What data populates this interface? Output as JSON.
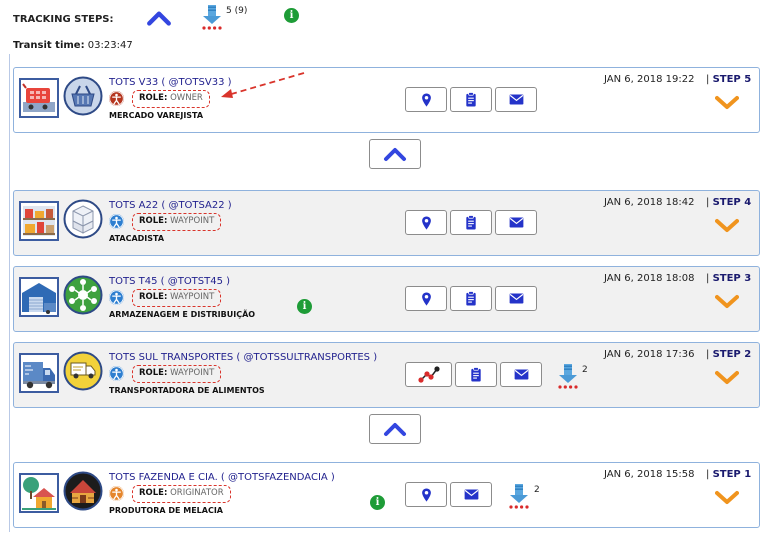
{
  "header": {
    "tracking_label": "TRACKING STEPS:",
    "download_count": "5 (9)",
    "info_symbol": "i",
    "transit_label": "Transit time:",
    "transit_value": "03:23:47"
  },
  "colors": {
    "card_border": "#8fb2dd",
    "link_blue": "#23238f",
    "role_dashed": "#d9342b",
    "chevron_orange": "#f0941e",
    "collapse_arrow": "#3346e0",
    "info_green": "#1e9c37"
  },
  "steps": [
    {
      "name": "TOTS V33 ( @TOTSV33 )",
      "role_key": "ROLE:",
      "role_value": "OWNER",
      "description": "MERCADO VAREJISTA",
      "date": "JAN 6, 2018 19:22",
      "step_prefix": "|",
      "step_label": "STEP 5",
      "actions": [
        "map-pin-icon",
        "clipboard-icon",
        "mail-icon"
      ]
    },
    {
      "name": "TOTS A22 ( @TOTSA22 )",
      "role_key": "ROLE:",
      "role_value": "WAYPOINT",
      "description": "ATACADISTA",
      "date": "JAN 6, 2018 18:42",
      "step_prefix": "|",
      "step_label": "STEP 4",
      "actions": [
        "map-pin-icon",
        "clipboard-icon",
        "mail-icon"
      ]
    },
    {
      "name": "TOTS T45 ( @TOTST45 )",
      "role_key": "ROLE:",
      "role_value": "WAYPOINT",
      "description": "ARMAZENAGEM E DISTRIBUIÇÃO",
      "date": "JAN 6, 2018 18:08",
      "step_prefix": "|",
      "step_label": "STEP 3",
      "actions": [
        "map-pin-icon",
        "clipboard-icon",
        "mail-icon"
      ]
    },
    {
      "name": "TOTS SUL TRANSPORTES ( @TOTSSULTRANSPORTES )",
      "role_key": "ROLE:",
      "role_value": "WAYPOINT",
      "description": "TRANSPORTADORA DE ALIMENTOS",
      "date": "JAN 6, 2018 17:36",
      "step_prefix": "|",
      "step_label": "STEP 2",
      "download_count": "2",
      "actions": [
        "route-icon",
        "clipboard-icon",
        "mail-icon"
      ]
    },
    {
      "name": "TOTS FAZENDA E CIA. ( @TOTSFAZENDACIA )",
      "role_key": "ROLE:",
      "role_value": "ORIGINATOR",
      "description": "PRODUTORA DE MELACIA",
      "date": "JAN 6, 2018 15:58",
      "step_prefix": "|",
      "step_label": "STEP 1",
      "download_count": "2",
      "actions": [
        "map-pin-icon",
        "mail-icon"
      ]
    }
  ]
}
